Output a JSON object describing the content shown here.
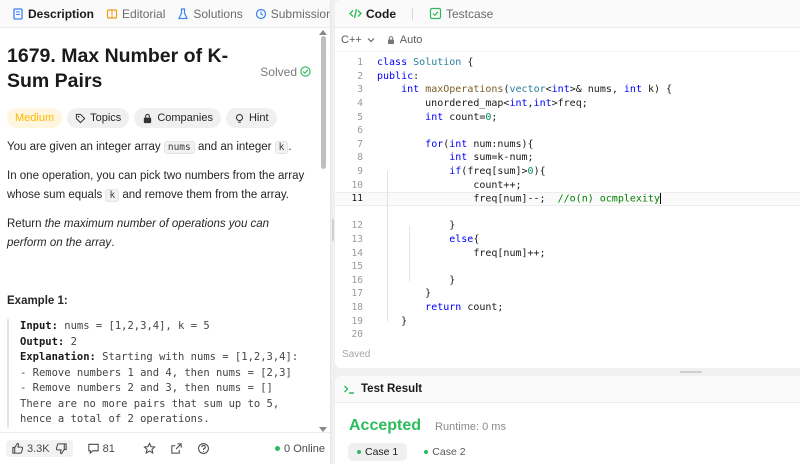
{
  "left_tabs": [
    {
      "label": "Description",
      "icon": "description-icon"
    },
    {
      "label": "Editorial",
      "icon": "editorial-icon"
    },
    {
      "label": "Solutions",
      "icon": "flask-icon"
    },
    {
      "label": "Submissions",
      "icon": "history-icon"
    }
  ],
  "problem": {
    "title": "1679. Max Number of K-Sum Pairs",
    "status": "Solved",
    "tags": [
      "Medium",
      "Topics",
      "Companies",
      "Hint"
    ],
    "desc1_pre": "You are given an integer array ",
    "desc1_code1": "nums",
    "desc1_mid": " and an integer ",
    "desc1_code2": "k",
    "desc1_post": ".",
    "desc2_pre": "In one operation, you can pick two numbers from the array whose sum equals ",
    "desc2_code": "k",
    "desc2_post": " and remove them from the array.",
    "desc3_pre": "Return ",
    "desc3_em": "the maximum number of operations you can perform on the array",
    "desc3_post": ".",
    "example_title": "Example 1:",
    "ex_input_label": "Input:",
    "ex_input": " nums = [1,2,3,4], k = 5",
    "ex_output_label": "Output:",
    "ex_output": " 2",
    "ex_expl_label": "Explanation:",
    "ex_expl": " Starting with nums = [1,2,3,4]:",
    "ex_l1": "- Remove numbers 1 and 4, then nums = [2,3]",
    "ex_l2": "- Remove numbers 2 and 3, then nums = []",
    "ex_l3": "There are no more pairs that sum up to 5, hence a total of 2 operations."
  },
  "footer": {
    "likes": "3.3K",
    "comments": "81",
    "online": "0 Online"
  },
  "code_tabs": [
    {
      "label": "Code",
      "icon": "code-icon"
    },
    {
      "label": "Testcase",
      "icon": "checkbox-icon"
    }
  ],
  "toolbar": {
    "language": "C++",
    "mode": "Auto"
  },
  "line_numbers": [
    "1",
    "2",
    "3",
    "4",
    "5",
    "6",
    "7",
    "8",
    "9",
    "10",
    "11",
    "12",
    "13",
    "14",
    "15",
    "16",
    "17",
    "18",
    "19",
    "20"
  ],
  "editor_status": "Saved",
  "result": {
    "title": "Test Result",
    "verdict": "Accepted",
    "runtime": "Runtime: 0 ms",
    "cases": [
      "Case 1",
      "Case 2"
    ]
  },
  "colors": {
    "accepted": "#2cbb5d",
    "medium": "#ffb800",
    "keyword": "#0000ff",
    "type": "#267f99",
    "comment": "#008000"
  }
}
